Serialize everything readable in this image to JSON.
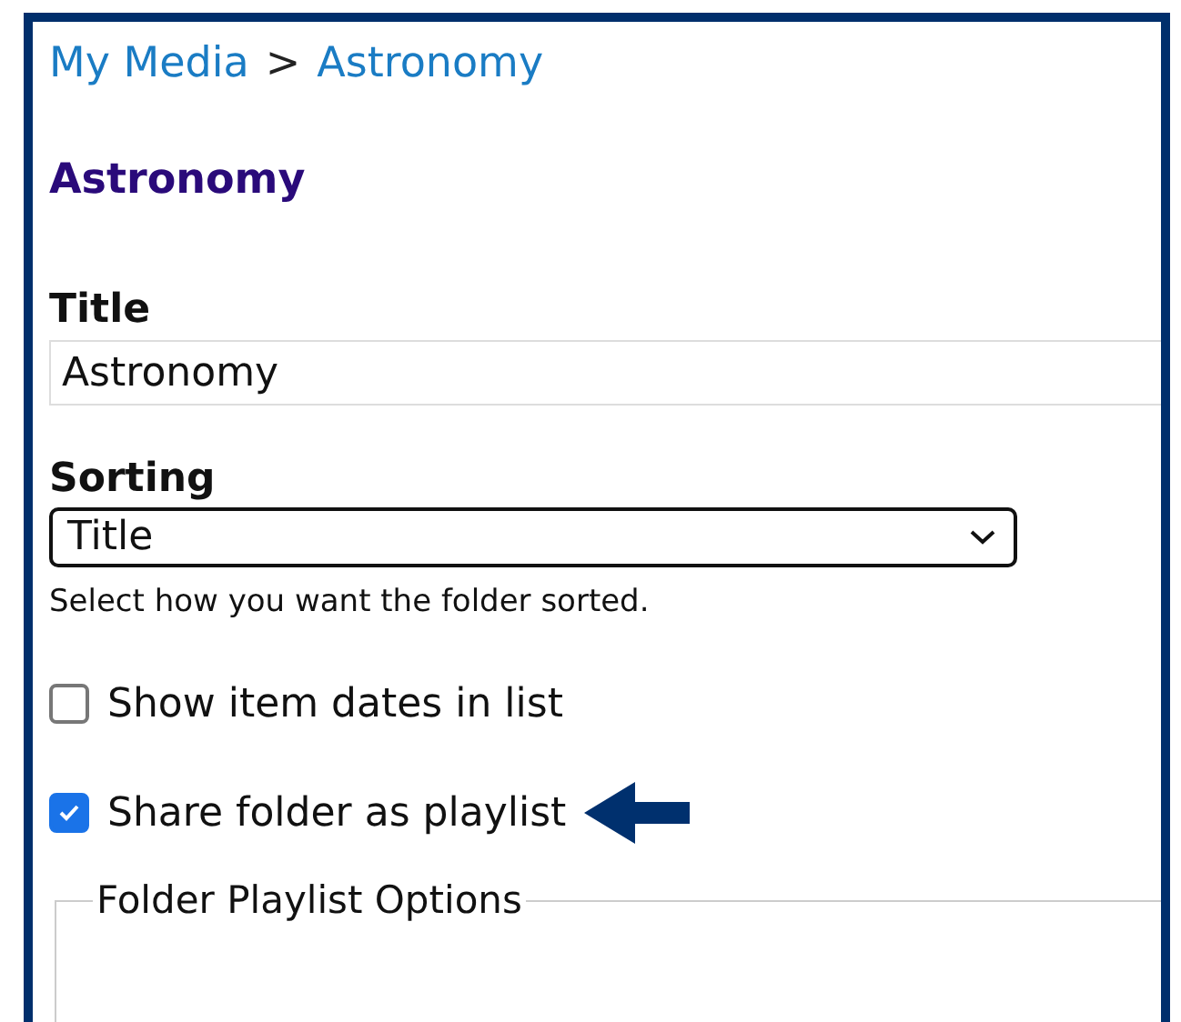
{
  "breadcrumb": [
    {
      "label": "My Media",
      "kind": "link"
    },
    {
      "label": ">",
      "kind": "separator"
    },
    {
      "label": "Astronomy",
      "kind": "link"
    }
  ],
  "heading": "Astronomy",
  "title_field": {
    "label": "Title",
    "value": "Astronomy"
  },
  "sorting_field": {
    "label": "Sorting",
    "value": "Title",
    "hint": "Select how you want the folder sorted."
  },
  "options": [
    {
      "label": "Show item dates in list",
      "checked": false,
      "arrow": false
    },
    {
      "label": "Share folder as playlist",
      "checked": true,
      "arrow": true
    }
  ],
  "fieldset": {
    "legend": "Folder Playlist Options"
  }
}
